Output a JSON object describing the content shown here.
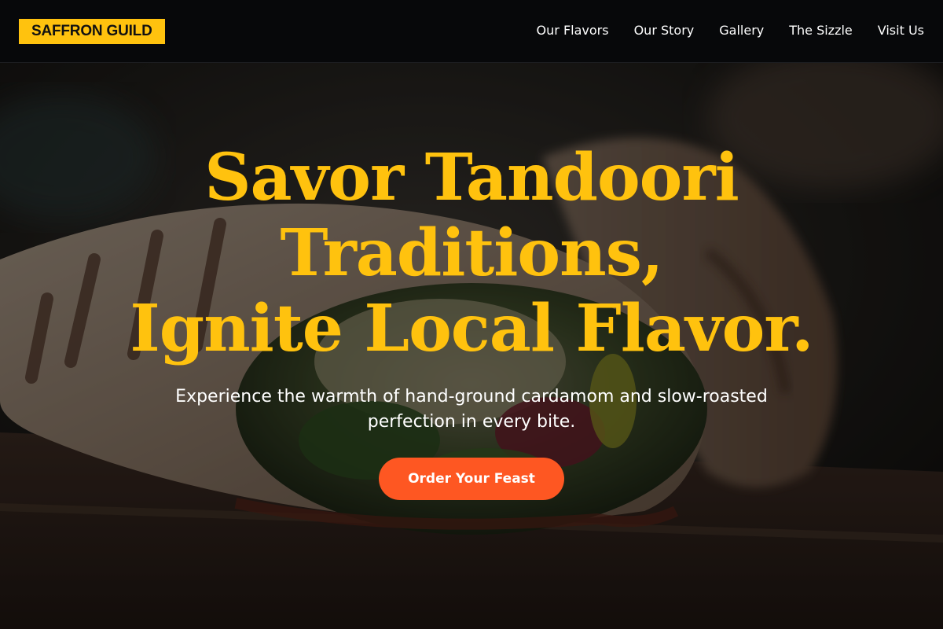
{
  "header": {
    "brand": "SAFFRON GUILD",
    "nav": [
      {
        "label": "Our Flavors"
      },
      {
        "label": "Our Story"
      },
      {
        "label": "Gallery"
      },
      {
        "label": "The Sizzle"
      },
      {
        "label": "Visit Us"
      }
    ]
  },
  "hero": {
    "title_lines": [
      "Savor Tandoori",
      "Traditions,",
      "Ignite Local Flavor."
    ],
    "subtitle": "Experience the warmth of hand-ground cardamom and slow-roasted perfection in every bite.",
    "cta_label": "Order Your Feast",
    "background_image": "grilled-wrap-photo"
  },
  "colors": {
    "accent": "#ffc20e",
    "cta": "#fe5722",
    "header_bg": "#07080a"
  }
}
